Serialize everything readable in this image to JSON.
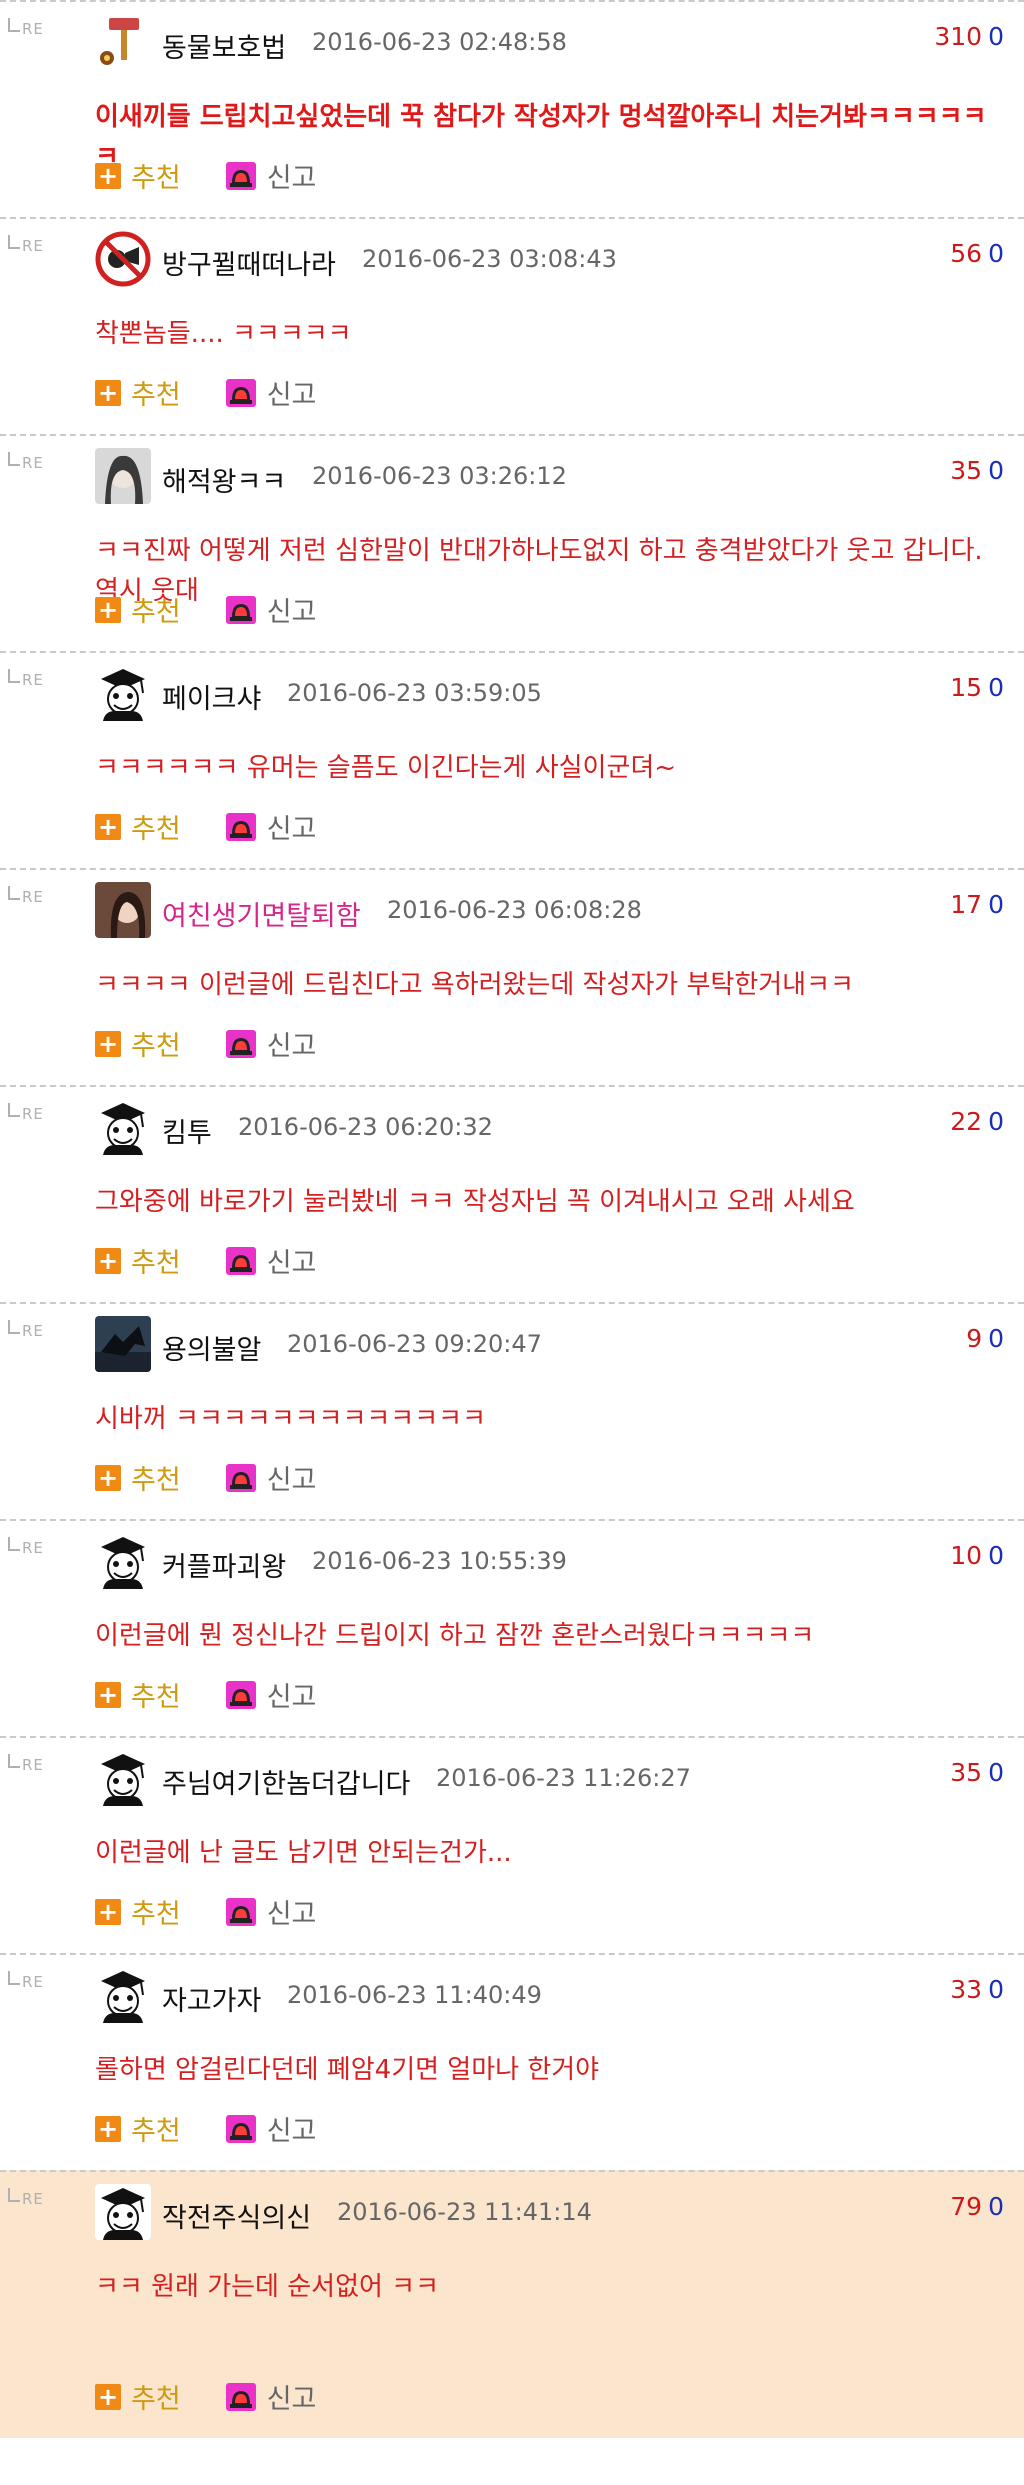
{
  "re_label": "RE",
  "recommend_label": "추천",
  "report_label": "신고",
  "comments": [
    {
      "nick": "동물보호법",
      "date": "2016-06-23 02:48:58",
      "score": "310",
      "zero": "0",
      "text": "이새끼들 드립치고싶었는데 꾹 참다가 작성자가 멍석깔아주니 치는거봐ㅋㅋㅋㅋㅋㅋ",
      "bold": true,
      "avatar": "hammer-avatar"
    },
    {
      "nick": "방구뀔때떠나라",
      "date": "2016-06-23 03:08:43",
      "score": "56",
      "zero": "0",
      "text": "착뽄놈들.... ㅋㅋㅋㅋㅋ",
      "bold": false,
      "avatar": "no-fart-avatar"
    },
    {
      "nick": "해적왕ㅋㅋ",
      "date": "2016-06-23 03:26:12",
      "score": "35",
      "zero": "0",
      "text": "ㅋㅋ진짜 어떻게 저런 심한말이 반대가하나도없지 하고 충격받았다가 웃고 갑니다. 역시 웃대",
      "bold": false,
      "avatar": "photo-avatar"
    },
    {
      "nick": "페이크샤",
      "date": "2016-06-23 03:59:05",
      "score": "15",
      "zero": "0",
      "text": "ㅋㅋㅋㅋㅋㅋ 유머는 슬픔도 이긴다는게 사실이군뎌~",
      "bold": false,
      "avatar": "graduate-avatar"
    },
    {
      "nick": "여친생기면탈퇴함",
      "date": "2016-06-23 06:08:28",
      "score": "17",
      "zero": "0",
      "text": "ㅋㅋㅋㅋ 이런글에 드립친다고 욕하러왔는데 작성자가 부탁한거내ㅋㅋ",
      "bold": false,
      "avatar": "girl-photo-avatar",
      "pink": true
    },
    {
      "nick": "킴투",
      "date": "2016-06-23 06:20:32",
      "score": "22",
      "zero": "0",
      "text": "그와중에 바로가기 눌러봤네 ㅋㅋ 작성자님 꼭 이겨내시고 오래 사세요",
      "bold": false,
      "avatar": "graduate-avatar"
    },
    {
      "nick": "용의불알",
      "date": "2016-06-23 09:20:47",
      "score": "9",
      "zero": "0",
      "text": "시바꺼 ㅋㅋㅋㅋㅋㅋㅋㅋㅋㅋㅋㅋㅋ",
      "bold": false,
      "avatar": "dragon-photo-avatar"
    },
    {
      "nick": "커플파괴왕",
      "date": "2016-06-23 10:55:39",
      "score": "10",
      "zero": "0",
      "text": "이런글에 뭔 정신나간 드립이지 하고 잠깐 혼란스러웠다ㅋㅋㅋㅋㅋ",
      "bold": false,
      "avatar": "graduate-avatar"
    },
    {
      "nick": "주님여기한놈더갑니다",
      "date": "2016-06-23 11:26:27",
      "score": "35",
      "zero": "0",
      "text": "이런글에 난 글도 남기면 안되는건가...",
      "bold": false,
      "avatar": "graduate-avatar"
    },
    {
      "nick": "자고가자",
      "date": "2016-06-23 11:40:49",
      "score": "33",
      "zero": "0",
      "text": "롤하면 암걸린다던데 폐암4기면 얼마나 한거야",
      "bold": false,
      "avatar": "graduate-avatar"
    },
    {
      "nick": "작전주식의신",
      "date": "2016-06-23 11:41:14",
      "score": "79",
      "zero": "0",
      "text": "ㅋㅋ 원래 가는데 순서없어 ㅋㅋ",
      "bold": false,
      "avatar": "graduate-avatar",
      "highlight": true
    }
  ]
}
